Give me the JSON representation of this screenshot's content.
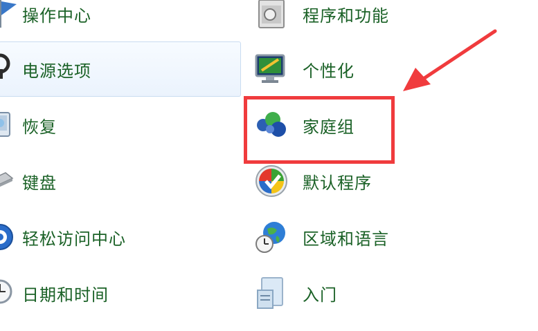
{
  "left_column": [
    {
      "label": "操作中心",
      "icon": "flag-icon"
    },
    {
      "label": "电源选项",
      "icon": "power-icon"
    },
    {
      "label": "恢复",
      "icon": "recovery-icon"
    },
    {
      "label": "键盘",
      "icon": "keyboard-icon"
    },
    {
      "label": "轻松访问中心",
      "icon": "accessibility-icon"
    },
    {
      "label": "日期和时间",
      "icon": "clock-icon"
    }
  ],
  "right_column": [
    {
      "label": "程序和功能",
      "icon": "programs-icon"
    },
    {
      "label": "个性化",
      "icon": "personalization-icon"
    },
    {
      "label": "家庭组",
      "icon": "homegroup-icon"
    },
    {
      "label": "默认程序",
      "icon": "default-programs-icon"
    },
    {
      "label": "区域和语言",
      "icon": "globe-clock-icon"
    },
    {
      "label": "入门",
      "icon": "getting-started-icon"
    }
  ],
  "colors": {
    "link_text": "#1a6126",
    "annotation_red": "#f03b3d",
    "hover_border": "#c9dcf1"
  }
}
